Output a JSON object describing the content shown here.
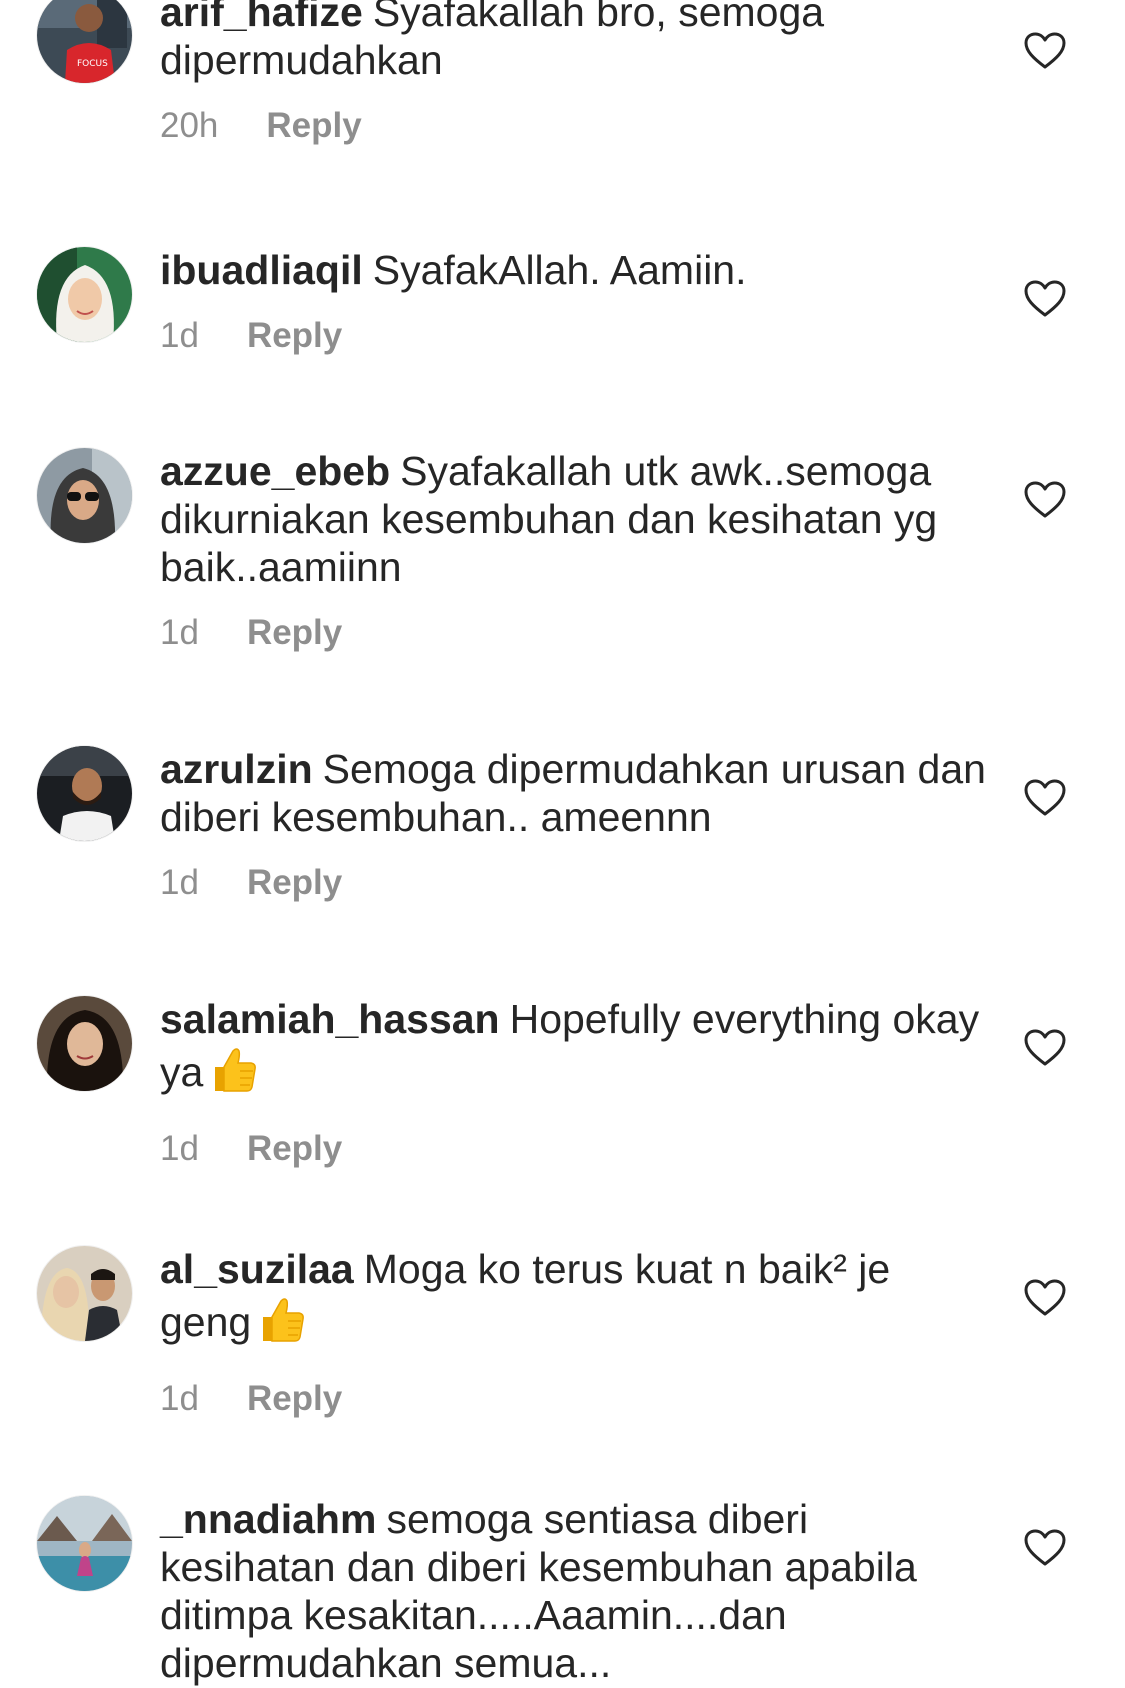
{
  "comments": [
    {
      "username": "arif_hafize",
      "text": "Syafakallah bro, semoga dipermudahkan",
      "time": "20h",
      "reply_label": "Reply",
      "avatar_icon": "avatar-red-shirt",
      "emoji": ""
    },
    {
      "username": "ibuadliaqil",
      "text": "SyafakAllah. Aamiin.",
      "time": "1d",
      "reply_label": "Reply",
      "avatar_icon": "avatar-hijab-white",
      "emoji": ""
    },
    {
      "username": "azzue_ebeb",
      "text": "Syafakallah utk awk..semoga dikurniakan kesembuhan dan kesihatan yg baik..aamiinn",
      "time": "1d",
      "reply_label": "Reply",
      "avatar_icon": "avatar-sunglasses",
      "emoji": ""
    },
    {
      "username": "azrulzin",
      "text": "Semoga dipermudahkan urusan dan diberi kesembuhan.. ameennn",
      "time": "1d",
      "reply_label": "Reply",
      "avatar_icon": "avatar-man-in-car",
      "emoji": ""
    },
    {
      "username": "salamiah_hassan",
      "text": "Hopefully everything okay ya",
      "time": "1d",
      "reply_label": "Reply",
      "avatar_icon": "avatar-woman-dark-hair",
      "emoji": "thumbs-up"
    },
    {
      "username": "al_suzilaa",
      "text": "Moga ko terus kuat n baik² je geng",
      "time": "1d",
      "reply_label": "Reply",
      "avatar_icon": "avatar-couple",
      "emoji": "thumbs-up"
    },
    {
      "username": "_nnadiahm",
      "text": "semoga sentiasa diberi kesihatan dan diberi kesembuhan apabila ditimpa kesakitan.....Aaamin....dan dipermudahkan semua...",
      "time": "",
      "reply_label": "",
      "avatar_icon": "avatar-outdoor-scene",
      "emoji": ""
    }
  ],
  "colors": {
    "text": "#262626",
    "meta": "#8e8e8e",
    "heart_outline": "#262626",
    "background": "#ffffff"
  },
  "icons": {
    "like": "heart-outline-icon"
  }
}
